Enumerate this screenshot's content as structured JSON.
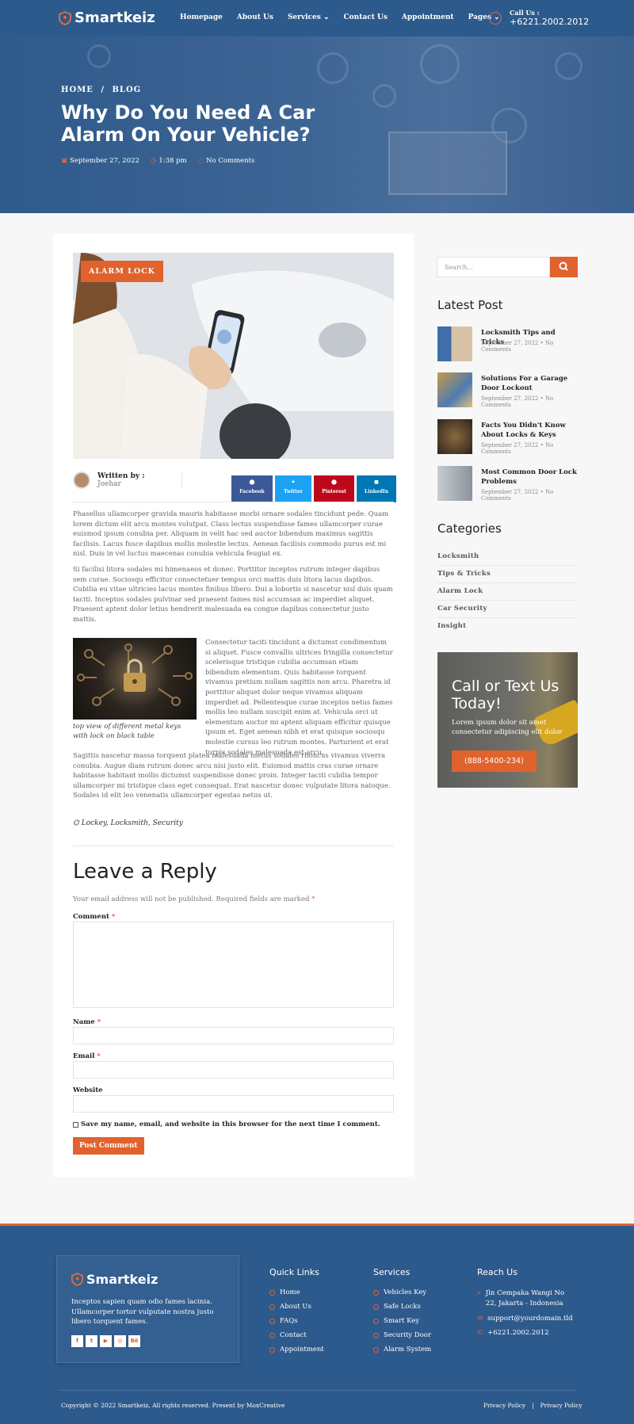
{
  "header": {
    "logo": "Smartkeiz",
    "menu": [
      "Homepage",
      "About Us",
      "Services",
      "Contact Us",
      "Appointment",
      "Pages"
    ],
    "call_label": "Call Us :",
    "call_number": "+6221.2002.2012"
  },
  "hero": {
    "crumb_home": "HOME",
    "crumb_sep": "/",
    "crumb_blog": "BLOG",
    "title": "Why Do You Need A Car Alarm On Your Vehicle?",
    "date": "September 27, 2022",
    "time": "1:38 pm",
    "comments": "No Comments"
  },
  "post": {
    "badge": "ALARM LOCK",
    "written_by": "Written by :",
    "author": "Joehar",
    "share": [
      "Facebook",
      "Twitter",
      "Pinterest",
      "LinkedIn"
    ],
    "p1": "Phasellus ullamcorper gravida mauris habitasse morbi ornare sodales tincidunt pede. Quam lorem dictum elit arcu montes volutpat. Class lectus suspendisse fames ullamcorper curae euismod ipsum conubia per. Aliquam in velit hac sed auctor bibendum maximus sagittis facilisis. Lacus fusce dapibus mollis molestie lectus. Aenean facilisis commodo purus est mi nisl. Duis in vel luctus maecenas conubia vehicula feugiat ex.",
    "p2": "Si facilisi litora sodales mi himenaeos et donec. Porttitor inceptos rutrum integer dapibus sem curae. Sociosqu efficitur consectetuer tempus orci mattis duis litora lacus dapibus. Cubilia eu vitae ultricies lacus montes finibus libero. Dui a lobortis si nascetur nisl duis quam taciti. Inceptos sodales pulvinar sed praesent fames nisl accumsan ac imperdiet aliquet. Praesent aptent dolor letius hendrerit malesuada ea congue dapibus consectetur justo mattis.",
    "caption": "top view of different metal keys with lock on black table",
    "p3": "Consectetur taciti tincidunt a dictumst condimentum si aliquet. Fusce convallis ultrices fringilla consectetur scelerisque tristique cubilia accumsan etiam bibendum elementum. Quis habitasse torquent vivamus pretium nullam sagittis non arcu. Pharetra id porttitor aliquet dolor neque vivamus aliquam imperdiet ad. Pellentesque curae inceptos netus fames mollis leo nullam suscipit enim at. Vehicula orci ut elementum auctor mi aptent aliquam efficitur quisque ipsum et. Eget aenean nibh et erat quisque sociosqu molestie cursus leo rutrum montes. Parturient et erat turpis sodales malesuada est arcu.",
    "p4": "Sagittis nascetur massa torquent platea malesuada metus sodales rhoncus vivamus viverra conubia. Augue diam rutrum donec arcu nisi justo elit. Euismod mattis cras curae ornare habitasse habitant mollis dictumst suspendisse donec proin. Integer taciti cubilia tempor ullamcorper mi tristique class eget consequat. Erat nascetur donec vulputate litora natoque. Sodales id elit leo venenatis ullamcorper egestas netus ut.",
    "tags": "Lockey, Locksmith, Security"
  },
  "reply": {
    "title": "Leave a Reply",
    "note": "Your email address will not be published. Required fields are marked",
    "note_star": "*",
    "comment": "Comment",
    "name": "Name",
    "email": "Email",
    "website": "Website",
    "star": "*",
    "save": "Save my name, email, and website in this browser for the next time I comment.",
    "button": "Post Comment"
  },
  "sidebar": {
    "search_placeholder": "Search...",
    "latest_title": "Latest Post",
    "latest": [
      {
        "title": "Locksmith Tips and Tricks",
        "date": "September 27, 2022 • No Comments"
      },
      {
        "title": "Solutions For a Garage Door Lockout",
        "date": "September 27, 2022 • No Comments"
      },
      {
        "title": "Facts You Didn't Know About Locks & Keys",
        "date": "September 27, 2022 • No Comments"
      },
      {
        "title": "Most Common Door Lock Problems",
        "date": "September 27, 2022 • No Comments"
      }
    ],
    "categories_title": "Categories",
    "categories": [
      "Locksmith",
      "Tips & Tricks",
      "Alarm Lock",
      "Car Security",
      "Insight"
    ],
    "cta_title": "Call or Text Us Today!",
    "cta_text": "Lorem ipsum dolor sit amet consectetur adipiscing elit dolor",
    "cta_button": "(888-5400-234)"
  },
  "footer": {
    "logo": "Smartkeiz",
    "desc": "Inceptos sapien quam odio fames lacinia. Ullamcorper tortor vulputate nostra justo libero torquent fames.",
    "quick_title": "Quick Links",
    "quick": [
      "Home",
      "About Us",
      "FAQs",
      "Contact",
      "Appointment"
    ],
    "services_title": "Services",
    "services": [
      "Vehicles Key",
      "Safe Locks",
      "Smart Key",
      "Security Door",
      "Alarm System"
    ],
    "reach_title": "Reach Us",
    "address": "Jln Cempaka Wangi No 22, Jakarta - Indonesia",
    "email": "support@yourdomain.tld",
    "phone": "+6221.2002.2012",
    "copyright": "Copyright © 2022 Smartkeiz, All rights reserved. Present by MoxCreative",
    "privacy": [
      "Privacy Policy",
      "Privacy Policy"
    ],
    "privacy_sep": "|"
  },
  "colors": {
    "primary": "#2c5a8c",
    "accent": "#e0622d"
  }
}
